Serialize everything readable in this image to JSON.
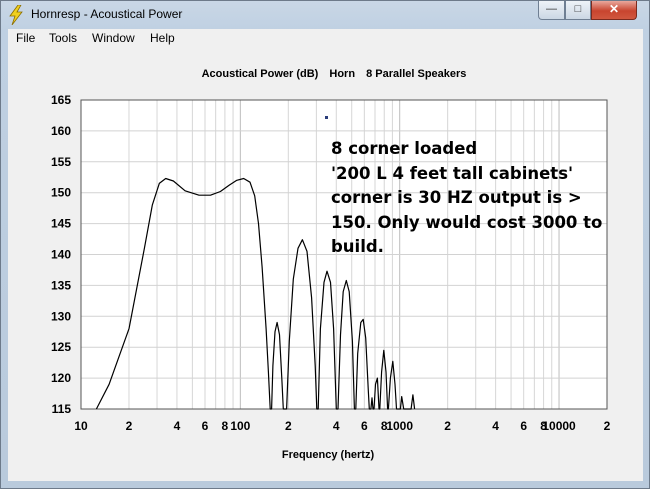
{
  "window": {
    "title": "Hornresp - Acoustical Power",
    "buttons": {
      "minimize": "—",
      "maximize": "□",
      "close": "✕"
    }
  },
  "menu": {
    "items": [
      "File",
      "Tools",
      "Window",
      "Help"
    ]
  },
  "chart_data": {
    "type": "line",
    "title_parts": [
      "Acoustical Power (dB)",
      "Horn",
      "8 Parallel Speakers"
    ],
    "xlabel": "Frequency (hertz)",
    "ylabel": "",
    "x_scale": "log",
    "xlim": [
      10,
      20000
    ],
    "ylim": [
      115,
      165
    ],
    "grid": true,
    "y_ticks": [
      "165",
      "160",
      "155",
      "150",
      "145",
      "140",
      "135",
      "130",
      "125",
      "120",
      "115"
    ],
    "x_ticks": [
      {
        "v": 10,
        "label": "10"
      },
      {
        "v": 20,
        "label": "2"
      },
      {
        "v": 40,
        "label": "4"
      },
      {
        "v": 60,
        "label": "6"
      },
      {
        "v": 80,
        "label": "8"
      },
      {
        "v": 100,
        "label": "100"
      },
      {
        "v": 200,
        "label": "2"
      },
      {
        "v": 400,
        "label": "4"
      },
      {
        "v": 600,
        "label": "6"
      },
      {
        "v": 800,
        "label": "8"
      },
      {
        "v": 1000,
        "label": "1000"
      },
      {
        "v": 2000,
        "label": "2"
      },
      {
        "v": 4000,
        "label": "4"
      },
      {
        "v": 6000,
        "label": "6"
      },
      {
        "v": 8000,
        "label": "8"
      },
      {
        "v": 10000,
        "label": "10000"
      },
      {
        "v": 20000,
        "label": "2"
      }
    ],
    "series": [
      {
        "points": [
          [
            12.5,
            115
          ],
          [
            15,
            119
          ],
          [
            20,
            128
          ],
          [
            25,
            141
          ],
          [
            28,
            148
          ],
          [
            31,
            151.5
          ],
          [
            34,
            152.3
          ],
          [
            38,
            151.9
          ],
          [
            45,
            150.3
          ],
          [
            55,
            149.6
          ],
          [
            65,
            149.6
          ],
          [
            75,
            150.2
          ],
          [
            85,
            151.2
          ],
          [
            95,
            152.0
          ],
          [
            105,
            152.3
          ],
          [
            115,
            151.7
          ],
          [
            123,
            149.5
          ],
          [
            130,
            145
          ],
          [
            137,
            138
          ],
          [
            145,
            128
          ],
          [
            150,
            121
          ],
          [
            154,
            115
          ],
          [
            157,
            115
          ],
          [
            160,
            122
          ],
          [
            165,
            127.5
          ],
          [
            170,
            129
          ],
          [
            176,
            127
          ],
          [
            182,
            120
          ],
          [
            186,
            115
          ],
          [
            195,
            115
          ],
          [
            203,
            126
          ],
          [
            215,
            136
          ],
          [
            230,
            141
          ],
          [
            245,
            142.4
          ],
          [
            262,
            140.5
          ],
          [
            280,
            133
          ],
          [
            295,
            122
          ],
          [
            302,
            115
          ],
          [
            308,
            115
          ],
          [
            318,
            128
          ],
          [
            335,
            135.5
          ],
          [
            350,
            137.3
          ],
          [
            368,
            135.5
          ],
          [
            385,
            128
          ],
          [
            400,
            115
          ],
          [
            410,
            115
          ],
          [
            425,
            127
          ],
          [
            442,
            134
          ],
          [
            462,
            135.8
          ],
          [
            482,
            134
          ],
          [
            505,
            126
          ],
          [
            520,
            115
          ],
          [
            530,
            115
          ],
          [
            545,
            124
          ],
          [
            570,
            129
          ],
          [
            590,
            129.5
          ],
          [
            612,
            126.5
          ],
          [
            635,
            118
          ],
          [
            645,
            115
          ],
          [
            660,
            115
          ],
          [
            670,
            116.8
          ],
          [
            680,
            115
          ],
          [
            690,
            115
          ],
          [
            705,
            119
          ],
          [
            725,
            120
          ],
          [
            742,
            115
          ],
          [
            750,
            115
          ],
          [
            770,
            121
          ],
          [
            795,
            124.5
          ],
          [
            820,
            121
          ],
          [
            840,
            115
          ],
          [
            850,
            115
          ],
          [
            875,
            120
          ],
          [
            905,
            122.7
          ],
          [
            935,
            119
          ],
          [
            955,
            115
          ],
          [
            1010,
            115
          ],
          [
            1030,
            117
          ],
          [
            1060,
            115
          ],
          [
            1180,
            115
          ],
          [
            1210,
            117.3
          ],
          [
            1240,
            115
          ]
        ]
      }
    ]
  },
  "annotation": {
    "lines": [
      "8 corner loaded",
      "'200 L 4 feet tall cabinets'",
      "corner is 30 HZ output is >",
      "150. Only would cost 3000 to",
      "build."
    ]
  }
}
